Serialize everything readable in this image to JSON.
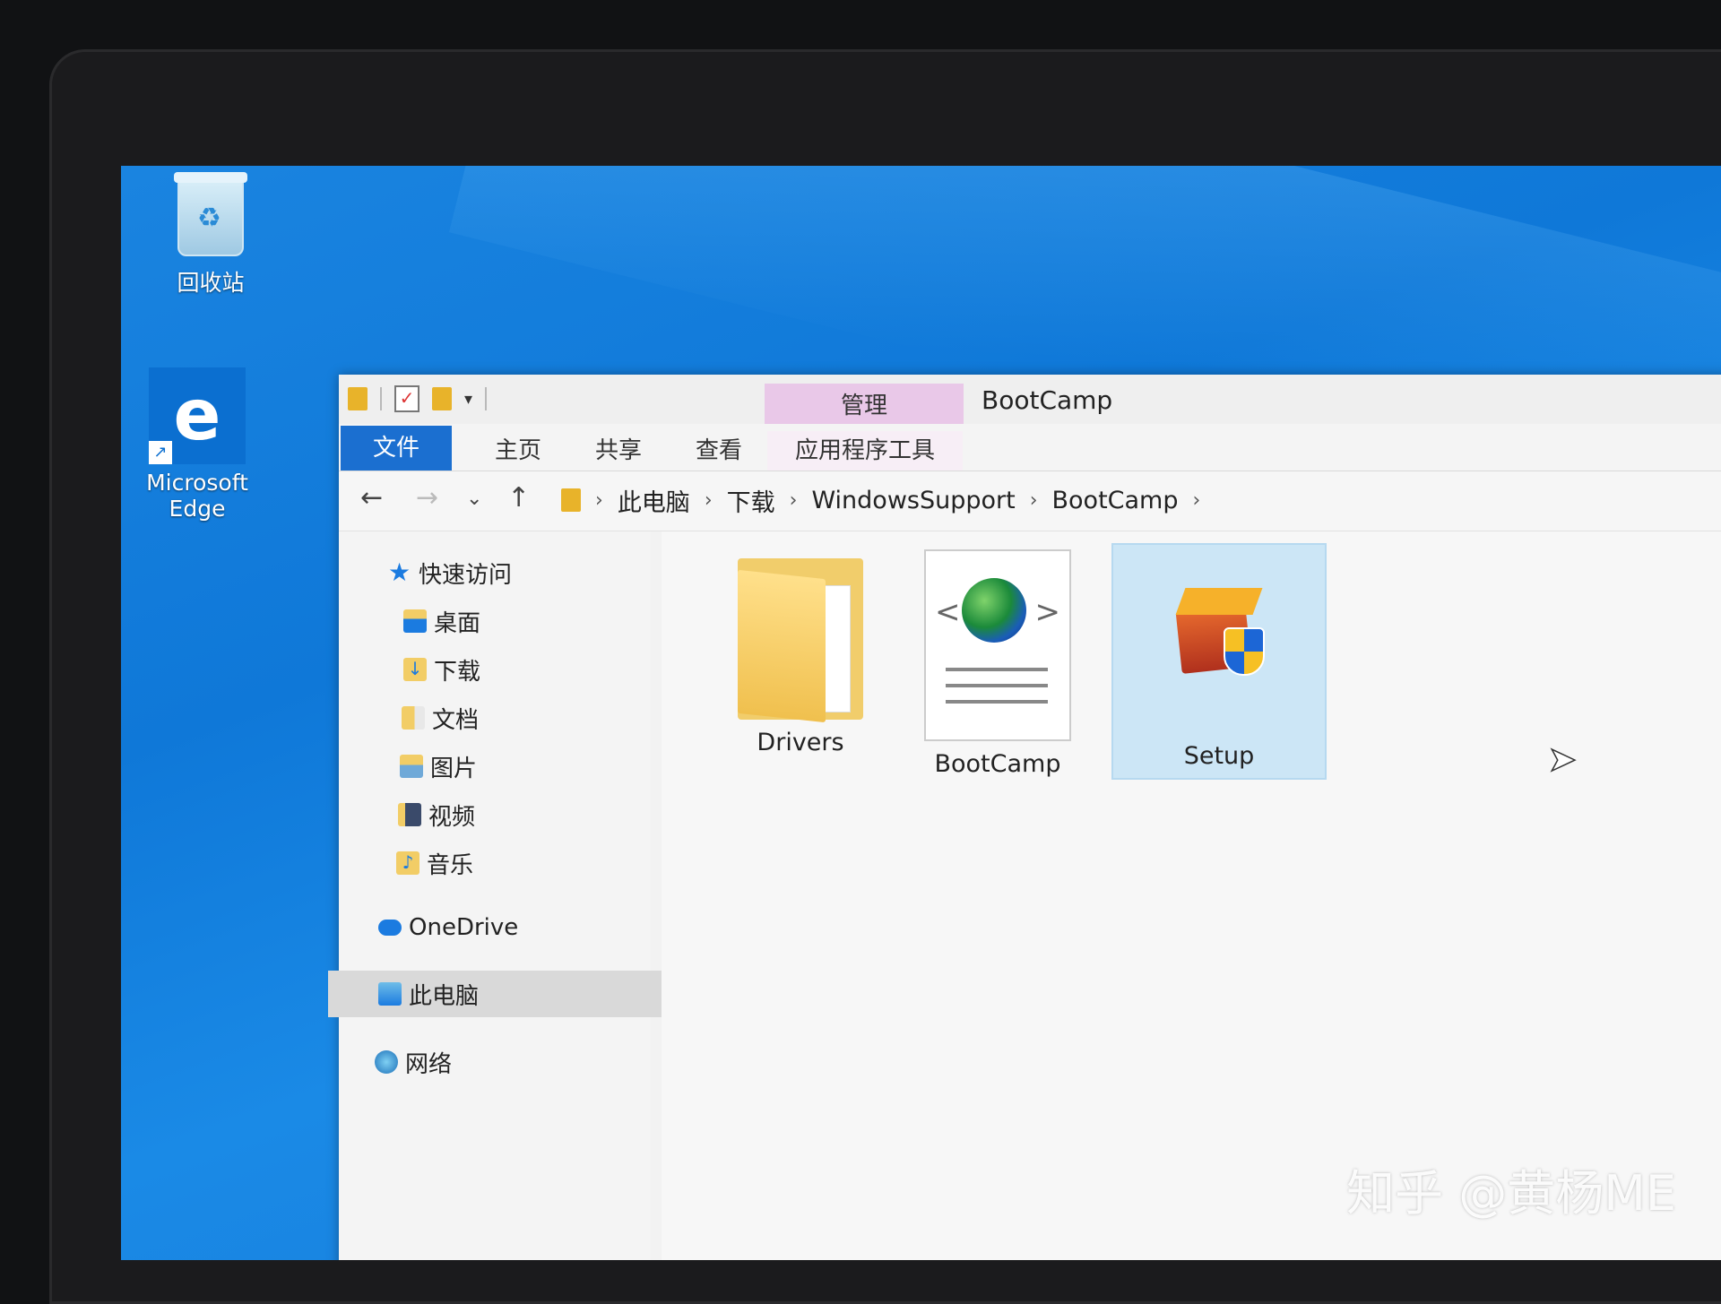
{
  "desktop": {
    "icons": [
      {
        "label": "回收站"
      },
      {
        "label": "Microsoft Edge",
        "line1": "Microsoft",
        "line2": "Edge"
      }
    ]
  },
  "window": {
    "title": "BootCamp",
    "context_tab_group": "管理",
    "ribbon_tabs": [
      {
        "label": "文件"
      },
      {
        "label": "主页"
      },
      {
        "label": "共享"
      },
      {
        "label": "查看"
      },
      {
        "label": "应用程序工具"
      }
    ],
    "breadcrumb": [
      "此电脑",
      "下载",
      "WindowsSupport",
      "BootCamp"
    ],
    "nav_pane": {
      "quick_access": "快速访问",
      "items": [
        "桌面",
        "下载",
        "文档",
        "图片",
        "视频",
        "音乐"
      ],
      "onedrive": "OneDrive",
      "this_pc": "此电脑",
      "network": "网络"
    },
    "files": [
      {
        "name": "Drivers",
        "type": "folder"
      },
      {
        "name": "BootCamp",
        "type": "html-document"
      },
      {
        "name": "Setup",
        "type": "installer",
        "selected": true
      }
    ]
  },
  "watermark": "知乎 @黄杨ME",
  "colors": {
    "desktop": "#1078d8",
    "file_tab": "#1b6fd0",
    "context_tab": "#e9c8e8",
    "selection": "#cce6f6"
  }
}
